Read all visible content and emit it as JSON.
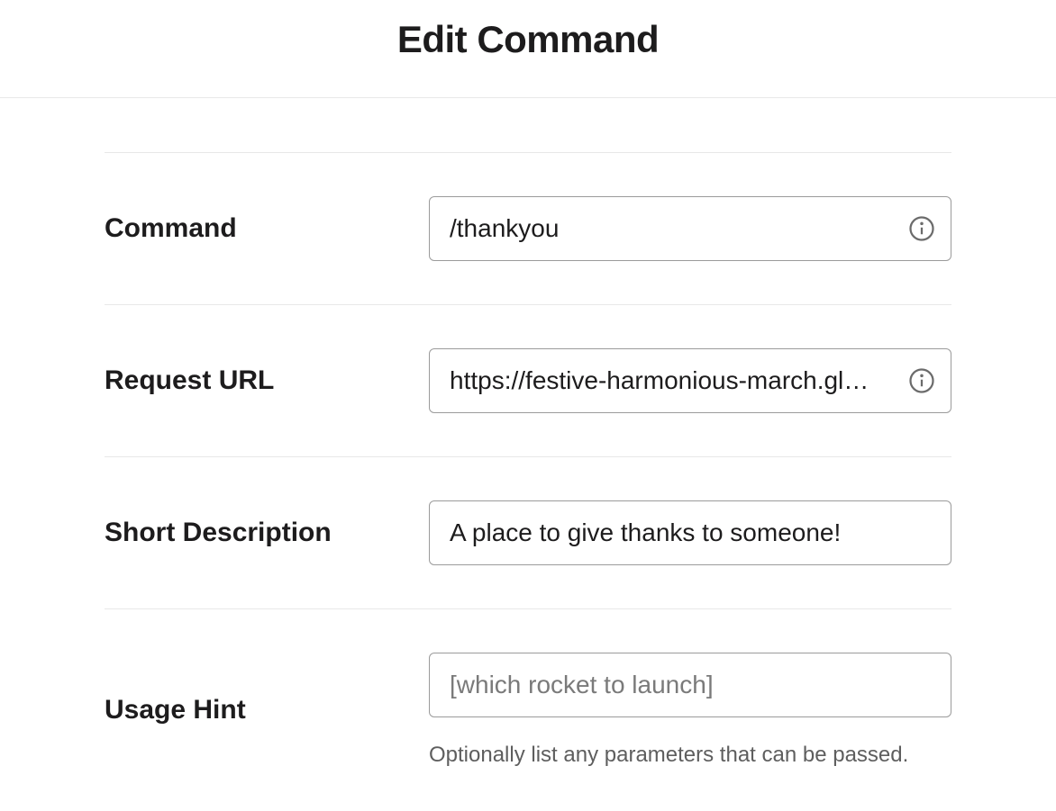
{
  "header": {
    "title": "Edit Command"
  },
  "form": {
    "command": {
      "label": "Command",
      "value": "/thankyou"
    },
    "request_url": {
      "label": "Request URL",
      "value": "https://festive-harmonious-march.gl…"
    },
    "short_description": {
      "label": "Short Description",
      "value": "A place to give thanks to someone!"
    },
    "usage_hint": {
      "label": "Usage Hint",
      "value": "",
      "placeholder": "[which rocket to launch]",
      "helper": "Optionally list any parameters that can be passed."
    }
  }
}
